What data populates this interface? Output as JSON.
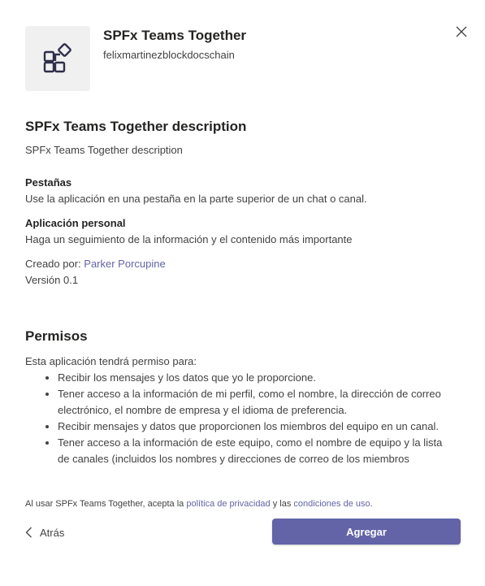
{
  "app": {
    "name": "SPFx Teams Together",
    "developer": "felixmartinezblockdocschain",
    "icon": "app-blocks-icon"
  },
  "description": {
    "title": "SPFx Teams Together description",
    "text": "SPFx Teams Together description"
  },
  "capabilities": [
    {
      "title": "Pestañas",
      "text": "Use la aplicación en una pestaña en la parte superior de un chat o canal."
    },
    {
      "title": "Aplicación personal",
      "text": "Haga un seguimiento de la información y el contenido más importante"
    }
  ],
  "creator": {
    "label": "Creado por:",
    "name": "Parker Porcupine"
  },
  "version": "Versión 0.1",
  "permissions": {
    "title": "Permisos",
    "intro": "Esta aplicación tendrá permiso para:",
    "items": [
      "Recibir los mensajes y los datos que yo le proporcione.",
      "Tener acceso a la información de mi perfil, como el nombre, la dirección de correo electrónico, el nombre de empresa y el idioma de preferencia.",
      "Recibir mensajes y datos que proporcionen los miembros del equipo en un canal.",
      "Tener acceso a la información de este equipo, como el nombre de equipo y la lista de canales (incluidos los nombres y direcciones de correo de los miembros"
    ]
  },
  "footer": {
    "prefix": "Al usar SPFx Teams Together, acepta la",
    "privacy_link": "política de privacidad",
    "middle": "y las",
    "terms_link": "condiciones de uso",
    "suffix": "."
  },
  "actions": {
    "back_label": "Atrás",
    "add_label": "Agregar"
  },
  "colors": {
    "accent": "#6264a7",
    "icon_bg": "#f0f0f0",
    "text": "#252423"
  }
}
